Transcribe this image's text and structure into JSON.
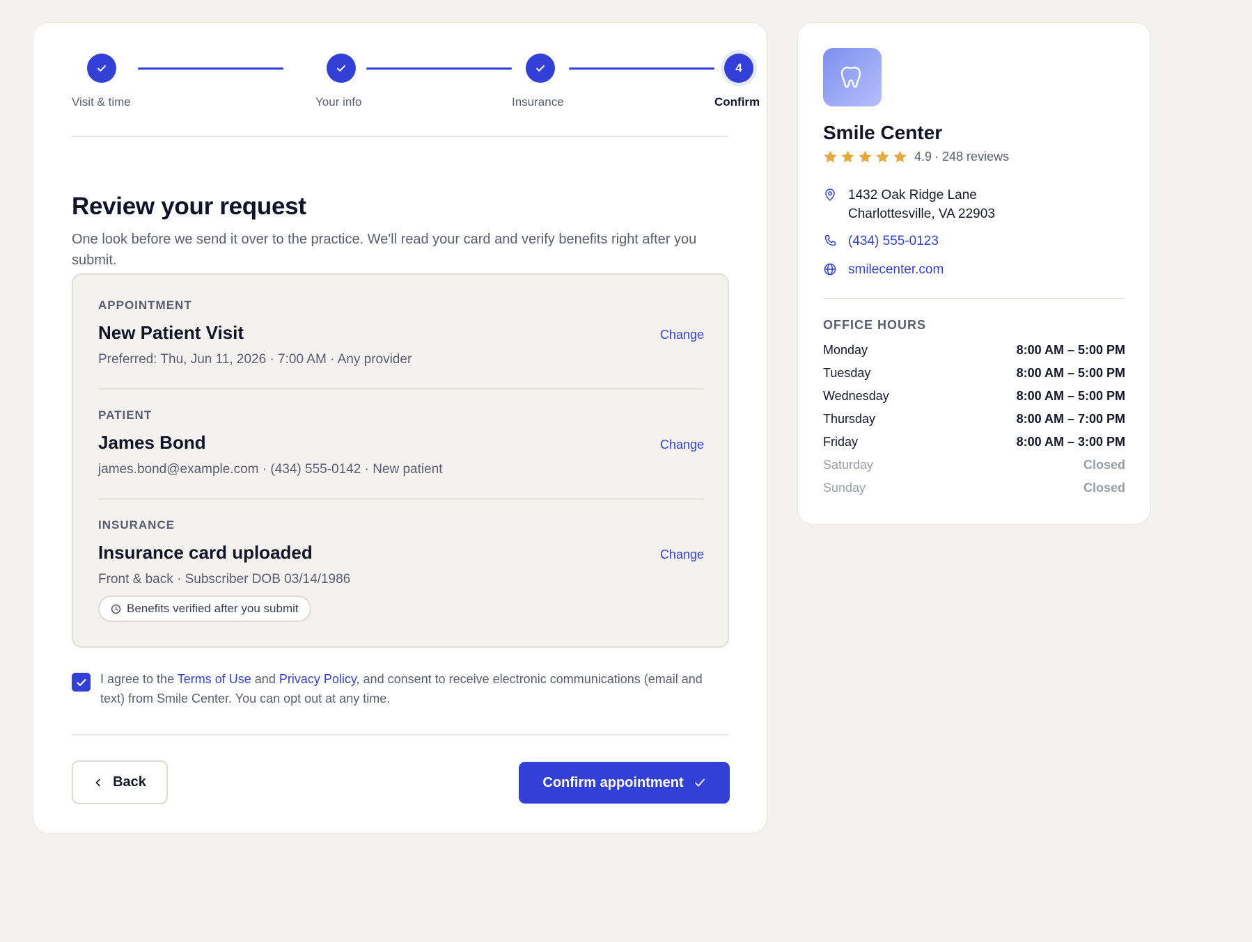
{
  "stepper": {
    "steps": [
      {
        "label": "Visit & time",
        "state": "complete"
      },
      {
        "label": "Your info",
        "state": "complete"
      },
      {
        "label": "Insurance",
        "state": "complete"
      },
      {
        "label": "Confirm",
        "state": "current",
        "number": "4"
      }
    ]
  },
  "review": {
    "title": "Review your request",
    "subtitle": "One look before we send it over to the practice. We'll read your card and verify benefits right after you submit.",
    "change_label": "Change",
    "sections": {
      "appointment": {
        "label": "APPOINTMENT",
        "title": "New Patient Visit",
        "detail": "Preferred: Thu, Jun 11, 2026 · 7:00 AM · Any provider"
      },
      "patient": {
        "label": "PATIENT",
        "title": "James Bond",
        "detail": "james.bond@example.com · (434) 555-0142 · New patient"
      },
      "insurance": {
        "label": "INSURANCE",
        "title": "Insurance card uploaded",
        "detail": "Front & back · Subscriber DOB 03/14/1986",
        "badge": "Benefits verified after you submit"
      }
    }
  },
  "consent": {
    "checked": true,
    "prefix": "I agree to the ",
    "terms_link": "Terms of Use",
    "middle": " and ",
    "privacy_link": "Privacy Policy",
    "suffix": ", and consent to receive electronic communications (email and text) from Smile Center. You can opt out at any time."
  },
  "actions": {
    "back_label": "Back",
    "confirm_label": "Confirm appointment"
  },
  "practice": {
    "name": "Smile Center",
    "rating": "4.9",
    "reviews": "· 248 reviews",
    "stars": 5,
    "star_color": "#e9a93a",
    "address_line1": "1432 Oak Ridge Lane",
    "address_line2": "Charlottesville, VA 22903",
    "phone": "(434) 555-0123",
    "website": "smilecenter.com"
  },
  "hours": {
    "title": "OFFICE HOURS",
    "days": [
      {
        "day": "Monday",
        "time": "8:00 AM – 5:00 PM",
        "closed": false
      },
      {
        "day": "Tuesday",
        "time": "8:00 AM – 5:00 PM",
        "closed": false
      },
      {
        "day": "Wednesday",
        "time": "8:00 AM – 5:00 PM",
        "closed": false
      },
      {
        "day": "Thursday",
        "time": "8:00 AM – 7:00 PM",
        "closed": false
      },
      {
        "day": "Friday",
        "time": "8:00 AM – 3:00 PM",
        "closed": false
      },
      {
        "day": "Saturday",
        "time": "Closed",
        "closed": true
      },
      {
        "day": "Sunday",
        "time": "Closed",
        "closed": true
      }
    ]
  },
  "colors": {
    "accent": "#3340d8",
    "background": "#f3f2ee"
  }
}
